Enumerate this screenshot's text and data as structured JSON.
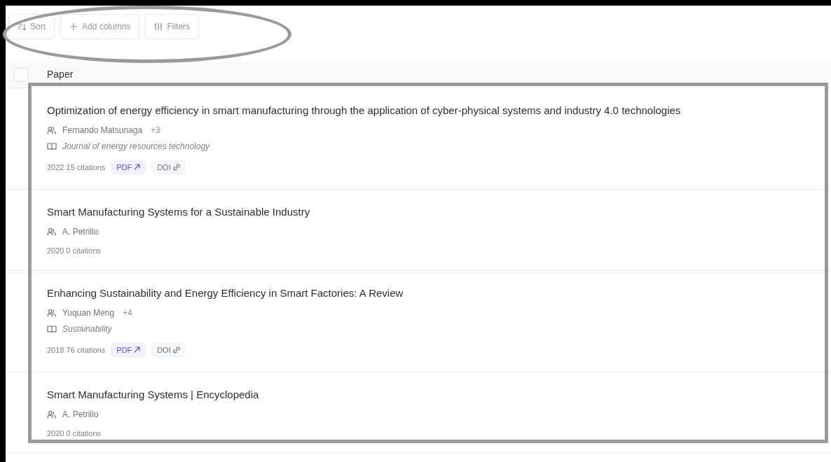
{
  "toolbar": [
    {
      "label": "Sort",
      "kind": "sort"
    },
    {
      "label": "Add columns",
      "kind": "add"
    },
    {
      "label": "Filters",
      "kind": "filter"
    }
  ],
  "header": {
    "checked": false,
    "label": "Paper"
  },
  "papers": [
    {
      "title": "Optimization of energy efficiency in smart manufacturing through the application of cyber-physical systems and industry 4.0 technologies",
      "author": "Fernando Matsunaga",
      "more": "+3",
      "journal": "Journal of energy resources technology",
      "year": "2022",
      "citations": "15 citations",
      "links": [
        {
          "label": "PDF",
          "kind": "pdf"
        },
        {
          "label": "DOI",
          "kind": "doi"
        }
      ]
    },
    {
      "title": "Smart Manufacturing Systems for a Sustainable Industry",
      "author": "A. Petrillo",
      "year": "2020",
      "citations": "0 citations"
    },
    {
      "title": "Enhancing Sustainability and Energy Efficiency in Smart Factories: A Review",
      "author": "Yuquan Meng",
      "more": "+4",
      "journal": "Sustainability",
      "year": "2018",
      "citations": "76 citations",
      "links": [
        {
          "label": "PDF",
          "kind": "pdf"
        },
        {
          "label": "DOI",
          "kind": "doi"
        }
      ]
    },
    {
      "title": "Smart Manufacturing Systems | Encyclopedia",
      "author": "A. Petrillo",
      "year": "2020",
      "citations": "0 citations"
    }
  ]
}
